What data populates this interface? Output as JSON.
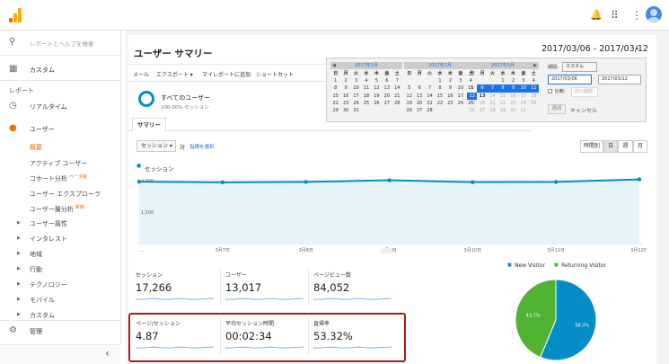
{
  "header": {
    "icons": [
      "bell-icon",
      "apps-grid-icon",
      "more-vert-icon",
      "account-icon"
    ]
  },
  "sidebar": {
    "search_placeholder": "レポートとヘルプを検索",
    "custom_label": "カスタム",
    "reports_heading": "レポート",
    "realtime_label": "リアルタイム",
    "users_label": "ユーザー",
    "overview_label": "概要",
    "active_users": "アクティブ ユーザー",
    "cohort": "コホート分析",
    "cohort_badge": "ベータ版",
    "explorer": "ユーザー エクスプローラ",
    "lifetime": "ユーザー層分析",
    "lifetime_badge": "新機",
    "attributes": "ユーザー属性",
    "interests": "インタレスト",
    "geo": "地域",
    "behavior": "行動",
    "technology": "テクノロジー",
    "mobile": "モバイル",
    "custom_sub": "カスタム",
    "admin_label": "管理",
    "collapse": "‹"
  },
  "page": {
    "title": "ユーザー サマリー",
    "date_range": "2017/03/06 - 2017/03/12",
    "toolbar": [
      "メール",
      "エクスポート ▾",
      "マイレポートに追加",
      "ショートカット"
    ],
    "segment_title": "すべてのユーザー",
    "segment_sub": "100.00% セッション",
    "tab": "サマリー",
    "metric_select": "セッション ▾",
    "vs_label": "対",
    "choose_metric": "指標を選択",
    "granularity": [
      "時間別",
      "日",
      "週",
      "月"
    ],
    "legend_metric": "セッション"
  },
  "calendar": {
    "months": [
      {
        "title": "2017年1月",
        "weekdays": [
          "日",
          "月",
          "火",
          "水",
          "木",
          "金",
          "土"
        ],
        "days": [
          "1",
          "2",
          "3",
          "4",
          "5",
          "6",
          "7",
          "8",
          "9",
          "10",
          "11",
          "12",
          "13",
          "14",
          "15",
          "16",
          "17",
          "18",
          "19",
          "20",
          "21",
          "22",
          "23",
          "24",
          "25",
          "26",
          "27",
          "28",
          "29",
          "30",
          "31",
          "",
          "",
          "",
          ""
        ],
        "offset": 0
      },
      {
        "title": "2017年2月",
        "weekdays": [
          "日",
          "月",
          "火",
          "水",
          "木",
          "金",
          "土"
        ],
        "days": [
          "1",
          "2",
          "3",
          "4",
          "5",
          "6",
          "7",
          "8",
          "9",
          "10",
          "11",
          "12",
          "13",
          "14",
          "15",
          "16",
          "17",
          "18",
          "19",
          "20",
          "21",
          "22",
          "23",
          "24",
          "25",
          "26",
          "27",
          "28"
        ],
        "offset": 3
      },
      {
        "title": "2017年3月",
        "weekdays": [
          "日",
          "月",
          "火",
          "水",
          "木",
          "金",
          "土"
        ],
        "days": [
          "1",
          "2",
          "3",
          "4",
          "5",
          "6",
          "7",
          "8",
          "9",
          "10",
          "11",
          "12",
          "13",
          "14",
          "15",
          "16",
          "17",
          "18",
          "19",
          "20",
          "21",
          "22",
          "23",
          "24",
          "25",
          "26",
          "27",
          "28",
          "29",
          "30",
          "31"
        ],
        "offset": 3
      }
    ],
    "period_label": "期間:",
    "period_value": "カスタム",
    "start": "2017/03/06",
    "end": "2017/03/12",
    "compare_label": "比較:",
    "compare_value": "前の期間",
    "apply": "適用",
    "cancel": "キャンセル"
  },
  "chart_data": {
    "type": "line",
    "series": [
      {
        "name": "セッション",
        "values": [
          2950,
          2920,
          2940,
          3020,
          2930,
          2940,
          3060
        ]
      }
    ],
    "x": [
      "...",
      "3月7日",
      "3月8日",
      "3月9日",
      "3月10日",
      "3月11日",
      "3月12日"
    ],
    "yticks": [
      "3,000",
      "1,500"
    ],
    "ylim": [
      0,
      3300
    ],
    "color": "#058dc7"
  },
  "kpis": [
    {
      "label": "セッション",
      "value": "17,266"
    },
    {
      "label": "ユーザー",
      "value": "13,017"
    },
    {
      "label": "ページビュー数",
      "value": "84,052"
    },
    {
      "label": "ページ/セッション",
      "value": "4.87"
    },
    {
      "label": "平均セッション時間",
      "value": "00:02:34"
    },
    {
      "label": "直帰率",
      "value": "53.32%"
    }
  ],
  "pie": {
    "legend": [
      "New Visitor",
      "Returning Visitor"
    ],
    "values": [
      56.3,
      43.7
    ],
    "labels": [
      "56.3%",
      "43.7%"
    ],
    "colors": [
      "#058dc7",
      "#50b432"
    ]
  }
}
